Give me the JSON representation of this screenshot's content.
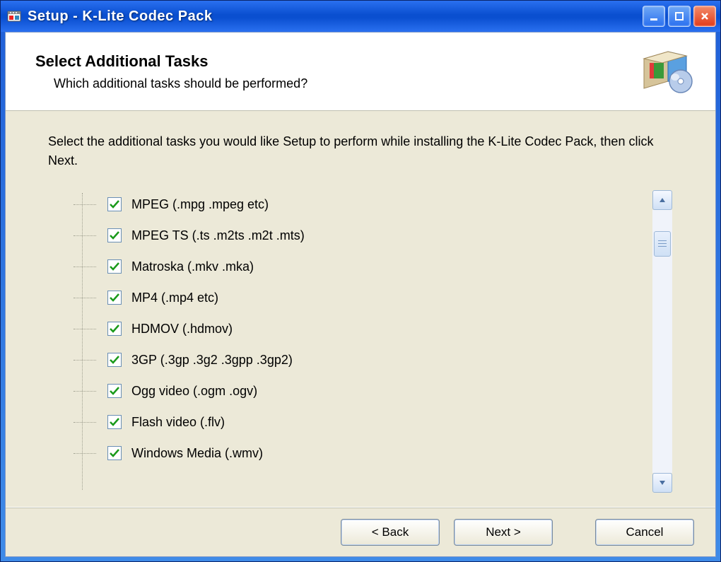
{
  "window": {
    "title": "Setup - K-Lite Codec Pack"
  },
  "header": {
    "heading": "Select Additional Tasks",
    "subheading": "Which additional tasks should be performed?"
  },
  "body": {
    "instructions": "Select the additional tasks you would like Setup to perform while installing the K-Lite Codec Pack, then click Next."
  },
  "tasks": [
    {
      "label": "MPEG (.mpg .mpeg etc)",
      "checked": true
    },
    {
      "label": "MPEG TS (.ts .m2ts .m2t .mts)",
      "checked": true
    },
    {
      "label": "Matroska (.mkv .mka)",
      "checked": true
    },
    {
      "label": "MP4 (.mp4 etc)",
      "checked": true
    },
    {
      "label": "HDMOV (.hdmov)",
      "checked": true
    },
    {
      "label": "3GP (.3gp .3g2 .3gpp .3gp2)",
      "checked": true
    },
    {
      "label": "Ogg video (.ogm .ogv)",
      "checked": true
    },
    {
      "label": "Flash video (.flv)",
      "checked": true
    },
    {
      "label": "Windows Media (.wmv)",
      "checked": true
    }
  ],
  "footer": {
    "back": "< Back",
    "next": "Next >",
    "cancel": "Cancel"
  }
}
